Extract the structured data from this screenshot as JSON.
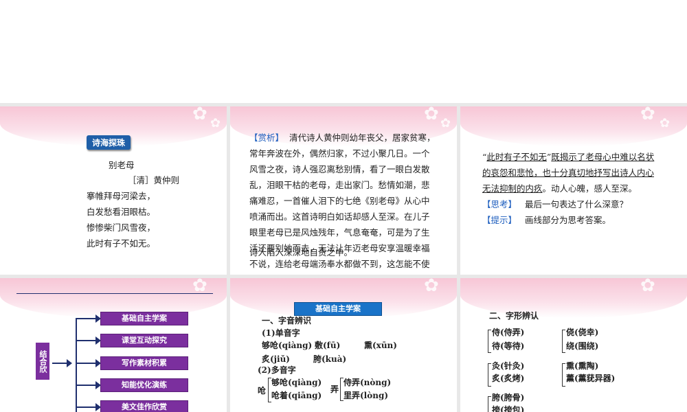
{
  "slide1": {
    "tag": "诗海探珠",
    "title": "别老母",
    "author": "［清］黄仲则",
    "lines": [
      "搴帷拜母河梁去，",
      "白发愁看泪眼枯。",
      "惨惨柴门风雪夜，",
      "此时有子不如无。"
    ]
  },
  "slide2": {
    "label": "【赏析】",
    "lines": [
      "清代诗人黄仲则幼年丧父，居家贫寒，",
      "常年奔波在外，偶然归家，不过小聚几日。一个",
      "风雪之夜，诗人强忍离愁别情，看了一眼白发散",
      "乱，泪眼干枯的老母，走出家门。愁情如潮，悲",
      "痛难忍，一首催人泪下的七绝《别老母》从心中",
      "喷涌而出。这首诗明白如话却感人至深。在儿子",
      "眼里老母已是风烛残年，气息奄奄，可是为了生",
      "活还要别她而去，无法让年迈老母安享温暖幸福",
      "不说，连给老母端汤奉水都做不到，这怎能不使",
      "诗人陷入深深地自责之中。"
    ]
  },
  "slide3": {
    "quote_open": "“",
    "quote": "此时有子不如无",
    "quote_close": "”",
    "line1_rest": "既揭示了老母心中难以名状",
    "line2": "的哀怨和悲怆，也十分真切地抒写出诗人内心",
    "line3_u": "无法抑制的内疚",
    "line3_rest": "。动人心魄，感人至深。",
    "think_label": "【思考】",
    "think": "最后一句表达了什么深意？",
    "hint_label": "【提示】",
    "hint": "画线部分为思考答案。"
  },
  "slide4": {
    "side_label": "结合欣",
    "menu": [
      "基础自主学案",
      "课堂互动探究",
      "写作素材积累",
      "知能优化演练",
      "美文佳作欣赏"
    ]
  },
  "slide5": {
    "tag": "基础自主学案",
    "h1": "一、字音辨识",
    "h2": "(1)单音字",
    "row1": [
      "够呛(qiàng)",
      "敷(fū)",
      "熏(xūn)"
    ],
    "row2": [
      "炙(jiǔ)",
      "胯(kuà)"
    ],
    "h3": "(2)多音字",
    "qiang_char": "呛",
    "qiang": [
      "够呛(qiàng)",
      "呛着(qiāng)"
    ],
    "nong_char": "弄",
    "nong": [
      "侍弄(nòng)",
      "里弄(lòng)"
    ]
  },
  "slide6": {
    "h1": "二、字形辨认",
    "g1": [
      "侍(侍弄)",
      "待(等待)"
    ],
    "g2": [
      "侥(侥幸)",
      "绕(围绕)"
    ],
    "g3": [
      "灸(针灸)",
      "炙(炙烤)"
    ],
    "g4": [
      "熏(熏陶)",
      "薰(薰莸异器)"
    ],
    "g5": [
      "胯(胯骨)",
      "挎(挎包)"
    ]
  }
}
